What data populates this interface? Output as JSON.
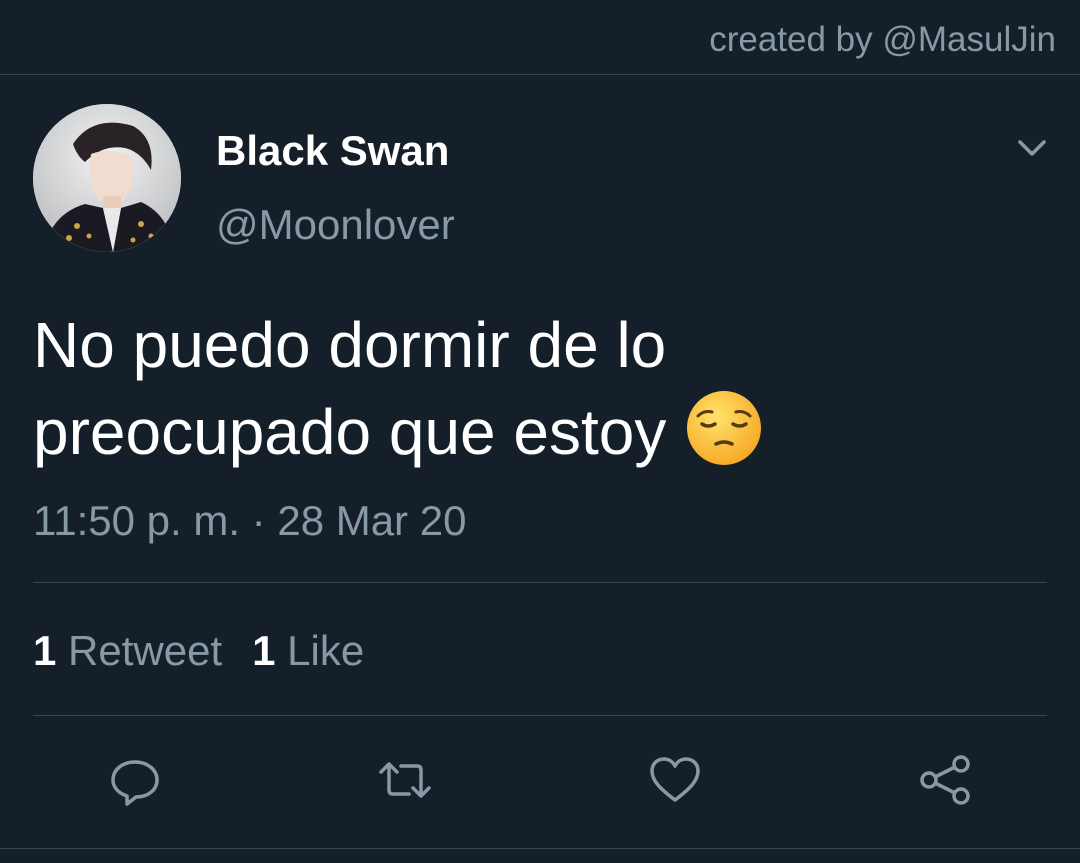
{
  "credit": "created by @MasulJin",
  "author": {
    "display_name": "Black Swan",
    "handle": "@Moonlover"
  },
  "tweet": {
    "text": "No puedo dormir de lo\npreocupado que estoy",
    "emoji": "pensive-face",
    "timestamp": "11:50 p. m. · 28 Mar 20"
  },
  "stats": {
    "retweets_count": "1",
    "retweets_label": "Retweet",
    "likes_count": "1",
    "likes_label": "Like"
  },
  "icons": {
    "caret": "chevron-down-icon",
    "reply": "reply-icon",
    "retweet": "retweet-icon",
    "like": "heart-icon",
    "share": "share-icon"
  },
  "colors": {
    "background": "#151f2a",
    "secondary_text": "#8899a6",
    "divider": "#38444d",
    "primary_text": "#ffffff"
  }
}
